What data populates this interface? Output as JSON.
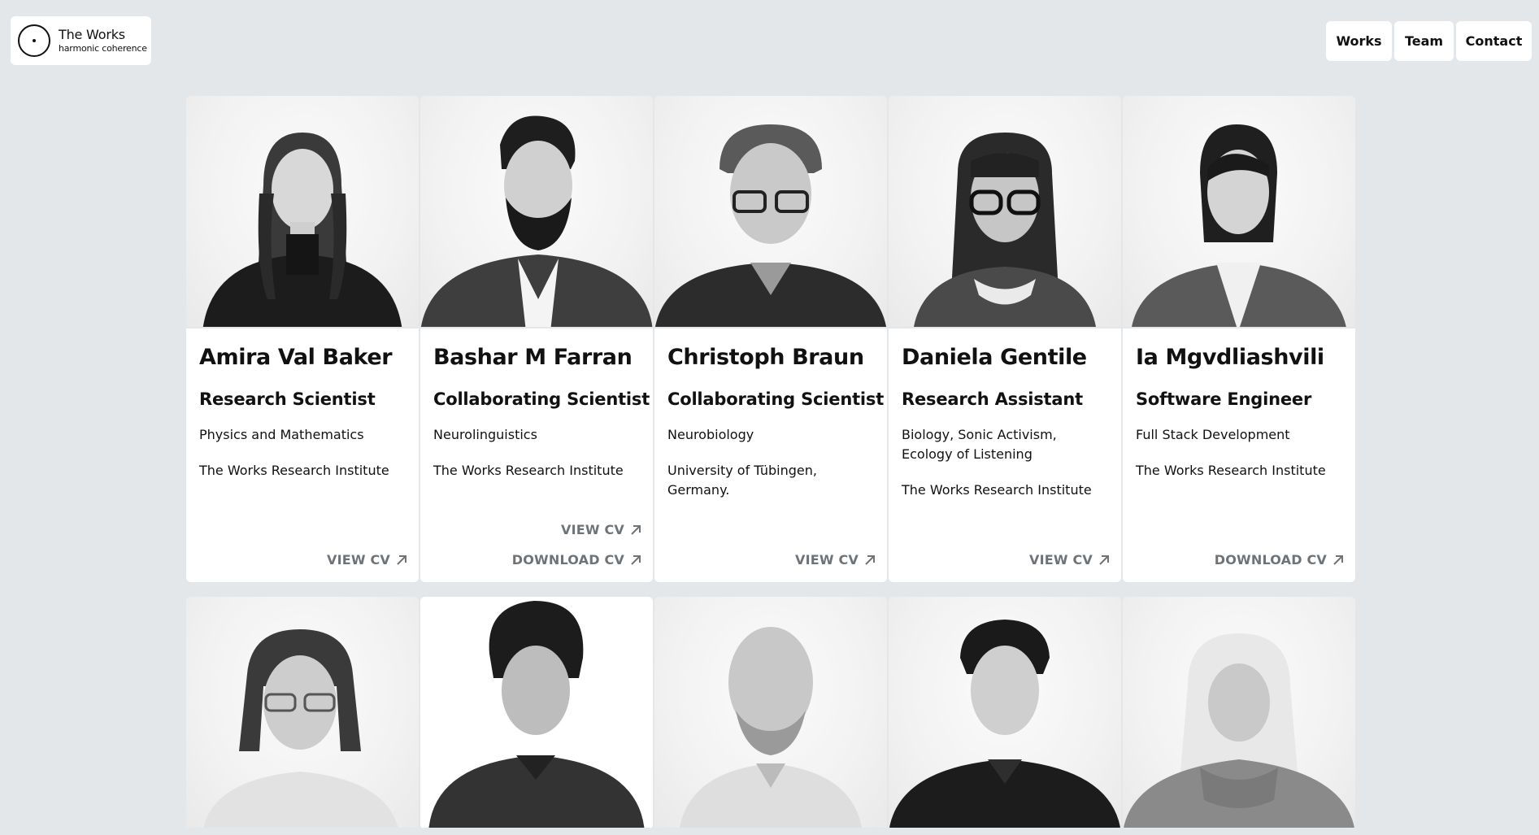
{
  "header": {
    "logo_title": "The Works",
    "logo_subtitle": "harmonic coherence",
    "nav": [
      {
        "label": "Works"
      },
      {
        "label": "Team"
      },
      {
        "label": "Contact"
      }
    ]
  },
  "team": [
    {
      "name": "Amira Val Baker",
      "role": "Research Scientist",
      "field": "Physics and Mathematics",
      "institution": "The Works Research Institute",
      "links": [
        "VIEW CV"
      ],
      "photo_icon": "portrait-woman-long-hair"
    },
    {
      "name": "Bashar M Farran",
      "role": "Collaborating Scientist",
      "field": "Neurolinguistics",
      "institution": "The Works Research Institute",
      "links": [
        "VIEW CV",
        "DOWNLOAD CV"
      ],
      "photo_icon": "portrait-man-beard"
    },
    {
      "name": "Christoph Braun",
      "role": "Collaborating Scientist",
      "field": "Neurobiology",
      "institution": "University of Tübingen, Germany.",
      "links": [
        "VIEW CV"
      ],
      "photo_icon": "portrait-man-glasses"
    },
    {
      "name": "Daniela Gentile",
      "role": "Research Assistant",
      "field": "Biology, Sonic Activism, Ecology of Listening",
      "institution": "The Works Research Institute",
      "links": [
        "VIEW CV"
      ],
      "photo_icon": "portrait-woman-glasses"
    },
    {
      "name": "Ia Mgvdliashvili",
      "role": "Software Engineer",
      "field": "Full Stack Development",
      "institution": "The Works Research Institute",
      "links": [
        "DOWNLOAD CV"
      ],
      "photo_icon": "portrait-woman-dark-hair"
    }
  ],
  "team_row2_photos": [
    "portrait-man-glasses-long-hair",
    "portrait-young-man-curly-hair",
    "portrait-bald-man",
    "portrait-young-man-polo",
    "portrait-woman-hijab"
  ],
  "colors": {
    "background": "#e3e7ea",
    "card": "#ffffff",
    "link": "#6e7378",
    "text": "#111111"
  }
}
